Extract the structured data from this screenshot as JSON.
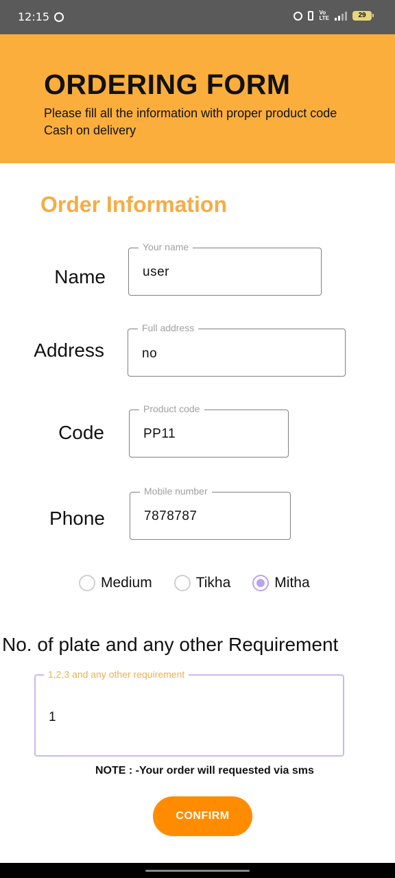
{
  "status_bar": {
    "time": "12:15",
    "battery": "29",
    "icons": [
      "whatsapp-icon",
      "alarm-icon",
      "vibrate-icon",
      "lte-icon",
      "signal-icon",
      "battery-icon"
    ]
  },
  "header": {
    "title": "ORDERING FORM",
    "subtitle_line1": "Please fill all the information with proper product code",
    "subtitle_line2": "Cash on delivery",
    "background_color": "#fbae3c"
  },
  "section": {
    "title": "Order Information",
    "title_color": "#f5ac44"
  },
  "fields": {
    "name": {
      "label": "Name",
      "legend": "Your name",
      "value": "user"
    },
    "address": {
      "label": "Address",
      "legend": "Full address",
      "value": "no"
    },
    "code": {
      "label": "Code",
      "legend": "Product code",
      "value": "PP11"
    },
    "phone": {
      "label": "Phone",
      "legend": "Mobile number",
      "value": "7878787"
    }
  },
  "taste": {
    "options": [
      "Medium",
      "Tikha",
      "Mitha"
    ],
    "selected": "Mitha"
  },
  "requirement": {
    "title": "No. of plate and any other Requirement",
    "legend": "1,2,3 and any other requirement",
    "value": "1"
  },
  "note": "NOTE : -Your order will requested via sms",
  "confirm_label": "CONFIRM",
  "accent_color": "#ff8c00"
}
